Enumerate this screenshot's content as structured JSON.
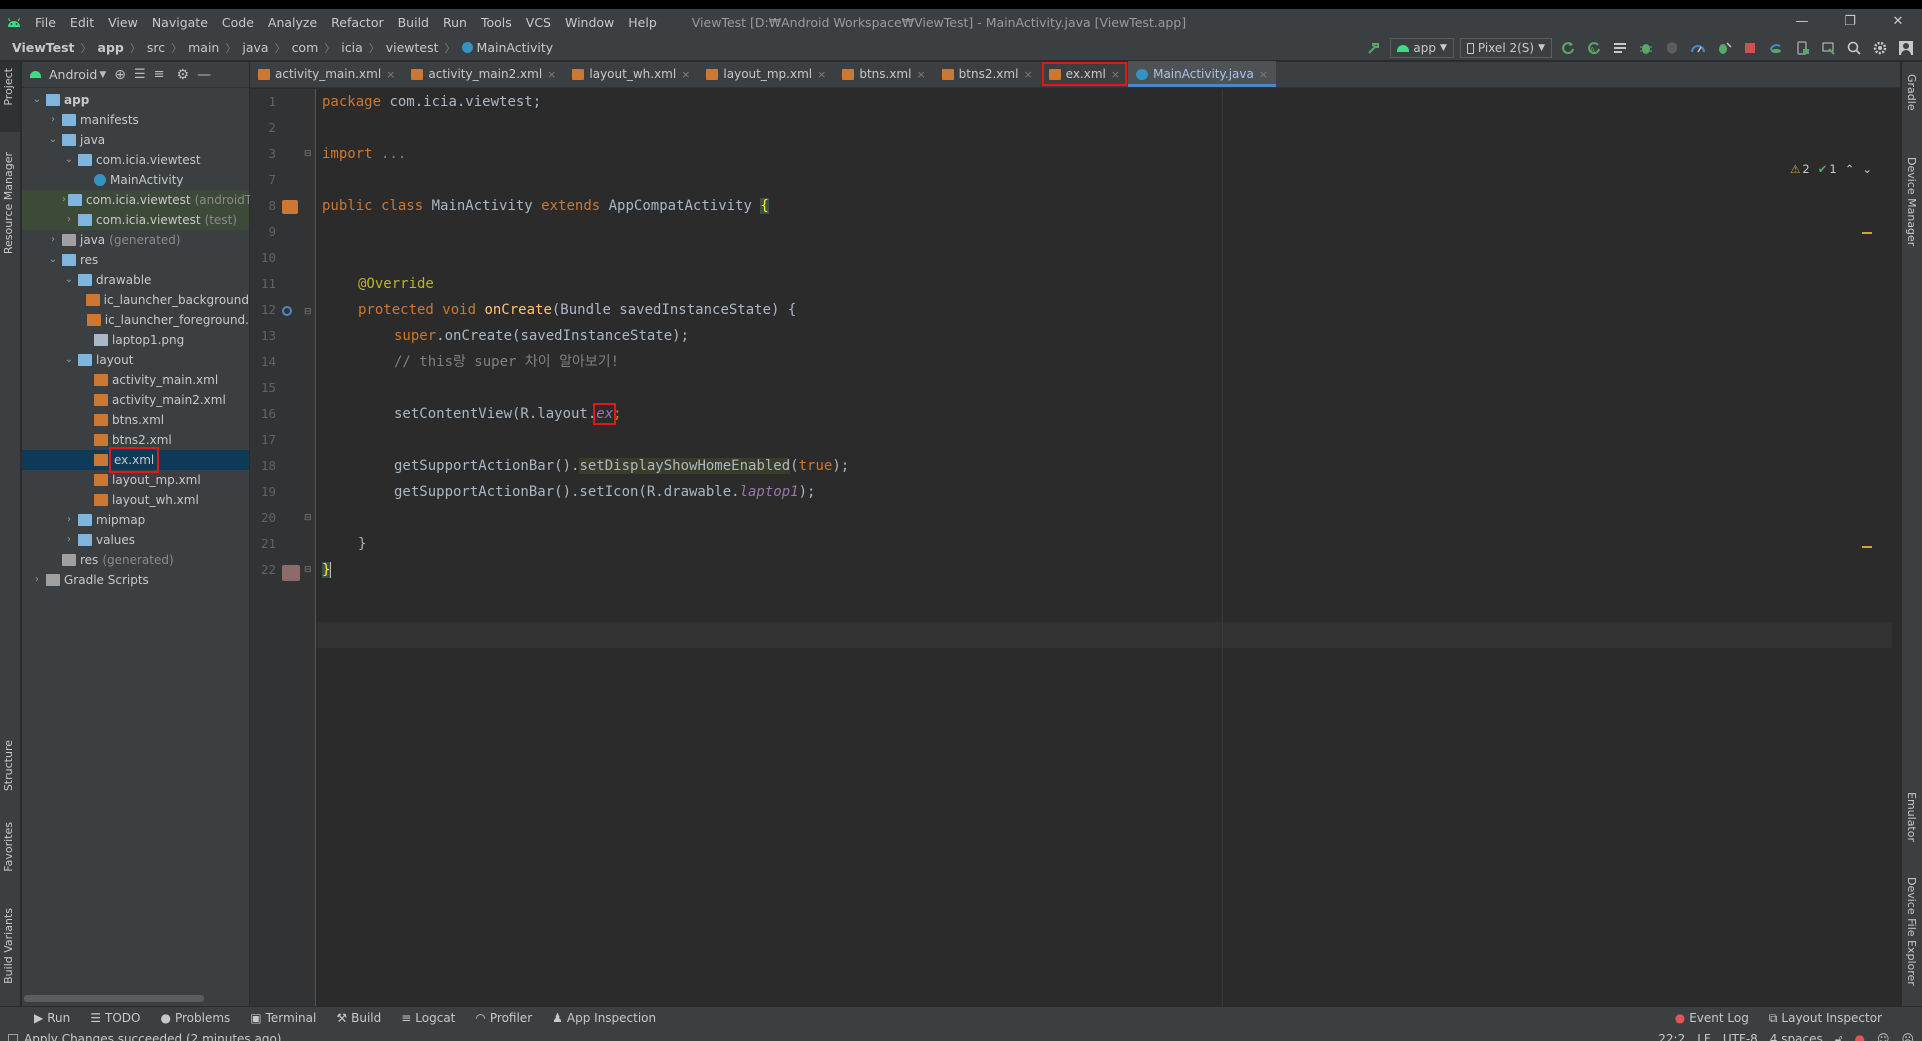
{
  "app": {
    "menu": [
      "File",
      "Edit",
      "View",
      "Navigate",
      "Code",
      "Analyze",
      "Refactor",
      "Build",
      "Run",
      "Tools",
      "VCS",
      "Window",
      "Help"
    ],
    "window_title": "ViewTest [D:₩Android Workspace₩ViewTest] - MainActivity.java [ViewTest.app]",
    "window_controls": [
      "—",
      "❐",
      "✕"
    ]
  },
  "breadcrumb": [
    "ViewTest",
    "app",
    "src",
    "main",
    "java",
    "com",
    "icia",
    "viewtest",
    "MainActivity"
  ],
  "toolbar": {
    "run_config": "app",
    "device": "Pixel 2(S)"
  },
  "side_tools": {
    "left": [
      "Project",
      "Resource Manager",
      "Structure",
      "Favorites",
      "Build Variants"
    ],
    "right": [
      "Gradle",
      "Device Manager",
      "Emulator",
      "Device File Explorer"
    ]
  },
  "project": {
    "view_mode": "Android",
    "tree": [
      {
        "label": "app",
        "depth": 0,
        "open": true,
        "type": "module"
      },
      {
        "label": "manifests",
        "depth": 1,
        "open": false,
        "type": "folder"
      },
      {
        "label": "java",
        "depth": 1,
        "open": true,
        "type": "folder"
      },
      {
        "label": "com.icia.viewtest",
        "depth": 2,
        "open": true,
        "type": "package"
      },
      {
        "label": "MainActivity",
        "depth": 3,
        "type": "class"
      },
      {
        "label": "com.icia.viewtest",
        "suffix": "(androidT",
        "depth": 2,
        "open": false,
        "type": "package",
        "hl": true
      },
      {
        "label": "com.icia.viewtest",
        "suffix": "(test)",
        "depth": 2,
        "open": false,
        "type": "package",
        "hl": true
      },
      {
        "label": "java",
        "suffix": "(generated)",
        "depth": 1,
        "open": false,
        "type": "folder-dim"
      },
      {
        "label": "res",
        "depth": 1,
        "open": true,
        "type": "folder"
      },
      {
        "label": "drawable",
        "depth": 2,
        "open": true,
        "type": "folder"
      },
      {
        "label": "ic_launcher_background",
        "depth": 3,
        "type": "xml"
      },
      {
        "label": "ic_launcher_foreground.",
        "depth": 3,
        "type": "xml"
      },
      {
        "label": "laptop1.png",
        "depth": 3,
        "type": "image"
      },
      {
        "label": "layout",
        "depth": 2,
        "open": true,
        "type": "folder"
      },
      {
        "label": "activity_main.xml",
        "depth": 3,
        "type": "xml"
      },
      {
        "label": "activity_main2.xml",
        "depth": 3,
        "type": "xml"
      },
      {
        "label": "btns.xml",
        "depth": 3,
        "type": "xml"
      },
      {
        "label": "btns2.xml",
        "depth": 3,
        "type": "xml"
      },
      {
        "label": "ex.xml",
        "depth": 3,
        "type": "xml",
        "selected": true
      },
      {
        "label": "layout_mp.xml",
        "depth": 3,
        "type": "xml"
      },
      {
        "label": "layout_wh.xml",
        "depth": 3,
        "type": "xml"
      },
      {
        "label": "mipmap",
        "depth": 2,
        "open": false,
        "type": "folder"
      },
      {
        "label": "values",
        "depth": 2,
        "open": false,
        "type": "folder"
      },
      {
        "label": "res",
        "suffix": "(generated)",
        "depth": 1,
        "type": "folder-dim",
        "noarrow": true
      },
      {
        "label": "Gradle Scripts",
        "depth": 0,
        "open": false,
        "type": "gradle"
      }
    ]
  },
  "tabs": [
    {
      "label": "activity_main.xml",
      "type": "xml"
    },
    {
      "label": "activity_main2.xml",
      "type": "xml"
    },
    {
      "label": "layout_wh.xml",
      "type": "xml"
    },
    {
      "label": "layout_mp.xml",
      "type": "xml"
    },
    {
      "label": "btns.xml",
      "type": "xml"
    },
    {
      "label": "btns2.xml",
      "type": "xml"
    },
    {
      "label": "ex.xml",
      "type": "xml",
      "boxed": true
    },
    {
      "label": "MainActivity.java",
      "type": "java",
      "active": true
    }
  ],
  "editor": {
    "line_numbers": [
      "1",
      "2",
      "3",
      "7",
      "8",
      "9",
      "10",
      "11",
      "12",
      "13",
      "14",
      "15",
      "16",
      "17",
      "18",
      "19",
      "20",
      "21",
      "22"
    ],
    "lines": {
      "l1": {
        "kw": "package",
        "rest": " com.icia.viewtest;"
      },
      "l3": {
        "kw": "import",
        "rest": " ..."
      },
      "l8": {
        "kw1": "public class",
        "name": " MainActivity ",
        "kw2": "extends",
        "rest": " AppCompatActivity ",
        "brace": "{"
      },
      "l11": {
        "ann": "@Override"
      },
      "l12": {
        "kw": "protected void",
        "fn": " onCreate",
        "rest": "(Bundle savedInstanceState) {"
      },
      "l13": {
        "kw": "super",
        "rest": ".onCreate(savedInstanceState);"
      },
      "l14": {
        "cm": "// this랑 super 차이 알아보기!"
      },
      "l16": {
        "pre": "setContentView(R.layout.",
        "it": "ex",
        "post": ";"
      },
      "l18": {
        "pre": "getSupportActionBar().",
        "hl": "setDisplayShowHomeEnabled",
        "mid": "(",
        "kw": "true",
        "post": ");"
      },
      "l19": {
        "pre": "getSupportActionBar().setIcon(R.drawable.",
        "it": "laptop1",
        "post": ");"
      },
      "l21": {
        "rest": "}"
      },
      "l22": {
        "rest": "}"
      }
    },
    "inspections": {
      "warnings": "2",
      "ok": "1"
    }
  },
  "bottom_tools": [
    "Run",
    "TODO",
    "Problems",
    "Terminal",
    "Build",
    "Logcat",
    "Profiler",
    "App Inspection"
  ],
  "bottom_right_tools": [
    "Event Log",
    "Layout Inspector"
  ],
  "status": {
    "message": "Apply Changes succeeded (2 minutes ago)",
    "position": "22:2",
    "line_sep": "LF",
    "encoding": "UTF-8",
    "indent": "4 spaces"
  },
  "colors": {
    "background": "#2b2b2b",
    "panel": "#3c3f41",
    "keyword": "#cc7832",
    "annotation": "#bbb529",
    "function": "#ffc66d",
    "comment": "#808080",
    "italic_field": "#9876aa",
    "highlight_box": "#e01818",
    "selection": "#0d3a58"
  }
}
